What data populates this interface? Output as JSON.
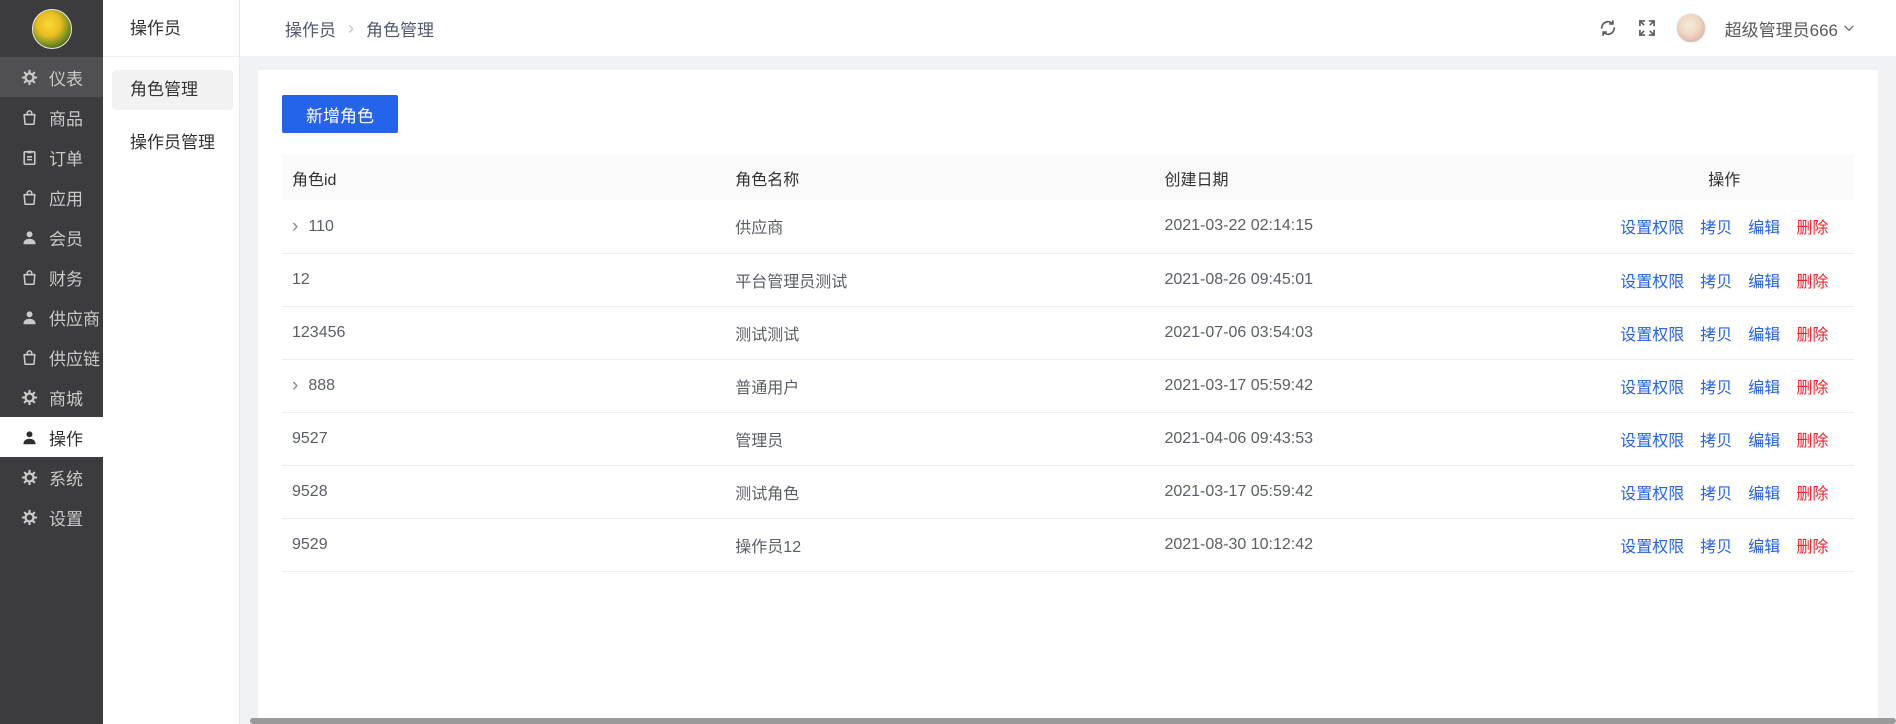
{
  "colors": {
    "primary": "#2563eb",
    "danger": "#f5222d",
    "sidebar_bg": "#3c3c3e"
  },
  "sidebar": {
    "logo": "flower-logo",
    "items": [
      {
        "key": "dashboard",
        "label": "仪表",
        "icon": "gauge-icon",
        "state": "highlighted"
      },
      {
        "key": "goods",
        "label": "商品",
        "icon": "bag-icon",
        "state": ""
      },
      {
        "key": "orders",
        "label": "订单",
        "icon": "clipboard-icon",
        "state": ""
      },
      {
        "key": "apps",
        "label": "应用",
        "icon": "bag-icon",
        "state": ""
      },
      {
        "key": "members",
        "label": "会员",
        "icon": "person-icon",
        "state": ""
      },
      {
        "key": "finance",
        "label": "财务",
        "icon": "bag-icon",
        "state": ""
      },
      {
        "key": "suppliers",
        "label": "供应商",
        "icon": "person-icon",
        "state": ""
      },
      {
        "key": "supply-chain",
        "label": "供应链",
        "icon": "bag-icon",
        "state": ""
      },
      {
        "key": "mall",
        "label": "商城",
        "icon": "gear-icon",
        "state": ""
      },
      {
        "key": "operations",
        "label": "操作",
        "icon": "person-icon",
        "state": "active"
      },
      {
        "key": "system",
        "label": "系统",
        "icon": "gear-icon",
        "state": ""
      },
      {
        "key": "settings",
        "label": "设置",
        "icon": "gear-icon",
        "state": ""
      }
    ]
  },
  "submenu": {
    "title": "操作员",
    "items": [
      {
        "key": "role-management",
        "label": "角色管理",
        "state": "active"
      },
      {
        "key": "operator-management",
        "label": "操作员管理",
        "state": ""
      }
    ]
  },
  "header": {
    "breadcrumb": [
      "操作员",
      "角色管理"
    ],
    "separator": "›",
    "tools": [
      "refresh-icon",
      "fullscreen-icon"
    ],
    "user": {
      "name": "超级管理员666"
    }
  },
  "toolbar": {
    "add_role_label": "新增角色"
  },
  "table": {
    "columns": [
      "角色id",
      "角色名称",
      "创建日期",
      "操作"
    ],
    "action_labels": [
      {
        "key": "set-permissions",
        "label": "设置权限",
        "color": "primary"
      },
      {
        "key": "copy",
        "label": "拷贝",
        "color": "primary"
      },
      {
        "key": "edit",
        "label": "编辑",
        "color": "primary"
      },
      {
        "key": "delete",
        "label": "删除",
        "color": "danger"
      }
    ],
    "rows": [
      {
        "id": "110",
        "expandable": true,
        "name": "供应商",
        "created": "2021-03-22 02:14:15"
      },
      {
        "id": "12",
        "expandable": false,
        "name": "平台管理员测试",
        "created": "2021-08-26 09:45:01"
      },
      {
        "id": "123456",
        "expandable": false,
        "name": "测试测试",
        "created": "2021-07-06 03:54:03"
      },
      {
        "id": "888",
        "expandable": true,
        "name": "普通用户",
        "created": "2021-03-17 05:59:42"
      },
      {
        "id": "9527",
        "expandable": false,
        "name": "管理员",
        "created": "2021-04-06 09:43:53"
      },
      {
        "id": "9528",
        "expandable": false,
        "name": "测试角色",
        "created": "2021-03-17 05:59:42"
      },
      {
        "id": "9529",
        "expandable": false,
        "name": "操作员12",
        "created": "2021-08-30 10:12:42"
      }
    ]
  }
}
